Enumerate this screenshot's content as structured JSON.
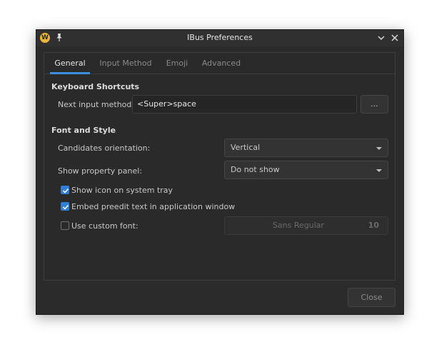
{
  "window": {
    "title": "IBus Preferences",
    "app_icon_letter": "W"
  },
  "tabs": [
    {
      "label": "General",
      "active": true
    },
    {
      "label": "Input Method",
      "active": false
    },
    {
      "label": "Emoji",
      "active": false
    },
    {
      "label": "Advanced",
      "active": false
    }
  ],
  "keyboard_shortcuts": {
    "heading": "Keyboard Shortcuts",
    "next_input_label": "Next input method:",
    "next_input_value": "<Super>space",
    "more_button": "..."
  },
  "font_style": {
    "heading": "Font and Style",
    "orientation_label": "Candidates orientation:",
    "orientation_value": "Vertical",
    "property_panel_label": "Show property panel:",
    "property_panel_value": "Do not show",
    "show_tray_label": "Show icon on system tray",
    "show_tray_checked": true,
    "embed_preedit_label": "Embed preedit text in application window",
    "embed_preedit_checked": true,
    "custom_font_label": "Use custom font:",
    "custom_font_checked": false,
    "font_name": "Sans Regular",
    "font_size": "10"
  },
  "footer": {
    "close_label": "Close"
  },
  "colors": {
    "accent": "#3d8fe0",
    "window_bg": "#2b2b2b"
  }
}
